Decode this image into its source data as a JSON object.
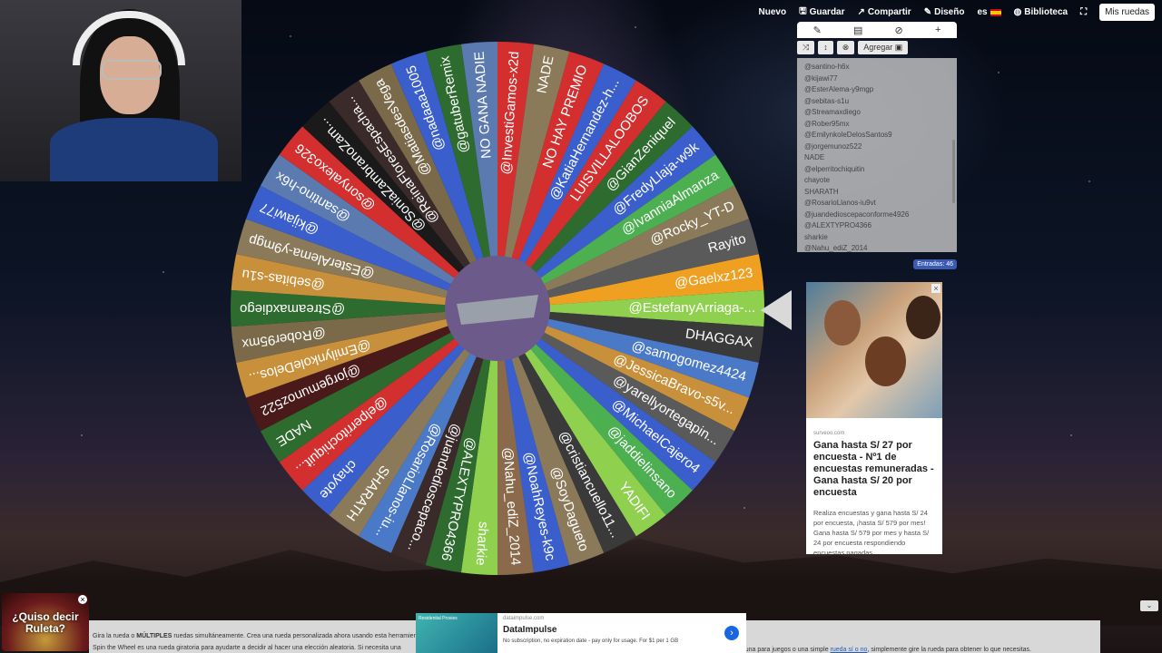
{
  "topnav": {
    "nuevo": "Nuevo",
    "guardar": "Guardar",
    "compartir": "Compartir",
    "diseno": "Diseño",
    "lang": "es",
    "biblioteca": "Biblioteca",
    "mis_ruedas": "Mis ruedas"
  },
  "wheel": {
    "slices": [
      {
        "label": "@Gaelxz123",
        "color": "#f0a020"
      },
      {
        "label": "@EstefanyArriaga-...",
        "color": "#8fd14f"
      },
      {
        "label": "DHAGGAX",
        "color": "#3a3a3a"
      },
      {
        "label": "@samogomez4424",
        "color": "#4a79c8"
      },
      {
        "label": "@JessicaBravo-s5v...",
        "color": "#c8903a"
      },
      {
        "label": "@yarellyortegapin...",
        "color": "#5a5a5a"
      },
      {
        "label": "@MichaelCajero4",
        "color": "#3a5fcd"
      },
      {
        "label": "@jaddielinsano",
        "color": "#4caf50"
      },
      {
        "label": "YADIFI",
        "color": "#8fd14f"
      },
      {
        "label": "@cristiancuello11...",
        "color": "#3a3a3a"
      },
      {
        "label": "@SoyDagueto",
        "color": "#8b7a5a"
      },
      {
        "label": "@NoahReyes-k9c",
        "color": "#3a5fcd"
      },
      {
        "label": "@Nahu_ediZ_2014",
        "color": "#8a6a4a"
      },
      {
        "label": "sharkie",
        "color": "#8fd14f"
      },
      {
        "label": "@ALEXTYPRO4366",
        "color": "#2e6b2e"
      },
      {
        "label": "@juandedioscepaco...",
        "color": "#3a2a2a"
      },
      {
        "label": "@RosarioLlanos-iu...",
        "color": "#4a79c8"
      },
      {
        "label": "SHARATH",
        "color": "#8b7a5a"
      },
      {
        "label": "chayote",
        "color": "#3a5fcd"
      },
      {
        "label": "@elperritochiquit...",
        "color": "#d32f2f"
      },
      {
        "label": "NADE",
        "color": "#2e6b2e"
      },
      {
        "label": "@jorgemunoz522",
        "color": "#4a1a1a"
      },
      {
        "label": "@EmilynkoleDelos...",
        "color": "#c8903a"
      },
      {
        "label": "@Rober95mx",
        "color": "#7a6a4a"
      },
      {
        "label": "@Streamaxdiego",
        "color": "#2e6b2e"
      },
      {
        "label": "@sebitas-s1u",
        "color": "#c8903a"
      },
      {
        "label": "@EsterAlema-y9mgp",
        "color": "#8b7a5a"
      },
      {
        "label": "@kijawi77",
        "color": "#3a5fcd"
      },
      {
        "label": "@santino-h6x",
        "color": "#5a7ab0"
      },
      {
        "label": "@sonyalexo326",
        "color": "#d32f2f"
      },
      {
        "label": "@SoniaZambranoZam...",
        "color": "#1a1a1a"
      },
      {
        "label": "@ReinaFloresEspacha...",
        "color": "#3a2a2a"
      },
      {
        "label": "@MatiasdesVega",
        "color": "#7a6a4a"
      },
      {
        "label": "@nadaaa1005",
        "color": "#3a5fcd"
      },
      {
        "label": "@gatuberRemix",
        "color": "#2e6b2e"
      },
      {
        "label": "NO GANA NADIE",
        "color": "#5a7ab0"
      },
      {
        "label": "@InvestiGamos-x2d",
        "color": "#d32f2f"
      },
      {
        "label": "NADE",
        "color": "#8b7a5a"
      },
      {
        "label": "NO HAY PREMIO",
        "color": "#d32f2f"
      },
      {
        "label": "@KatiaHernandez-h...",
        "color": "#3a5fcd"
      },
      {
        "label": "LUISVILLALOOBOS",
        "color": "#d32f2f"
      },
      {
        "label": "@GianZeniquel",
        "color": "#2e6b2e"
      },
      {
        "label": "@FredyLlaja-w9k",
        "color": "#3a5fcd"
      },
      {
        "label": "@IvanniaAlmanza",
        "color": "#4caf50"
      },
      {
        "label": "@Rocky_YT-D",
        "color": "#8b7a5a"
      },
      {
        "label": "Rayito",
        "color": "#5a5a5a"
      }
    ]
  },
  "panel": {
    "tabs": [
      "✎",
      "▤",
      "⊘",
      "+"
    ],
    "tools": [
      "⤨",
      "↕",
      "⊗",
      "Agregar ▣"
    ],
    "entries": [
      "@santino-h6x",
      "@kijawi77",
      "@EsterAlema-y9mgp",
      "@sebitas-s1u",
      "@Streamaxdiego",
      "@Rober95mx",
      "@EmilynkoleDelosSantos9",
      "@jorgemunoz522",
      "NADE",
      "@elperritochiquitin",
      "chayote",
      "SHARATH",
      "@RosarioLlanos-iu9vt",
      "@juandedioscepaconforme4926",
      "@ALEXTYPRO4366",
      "sharkie",
      "@Nahu_ediZ_2014"
    ],
    "count": "Entradas: 46"
  },
  "ad": {
    "source": "surveoo.com",
    "title": "Gana hasta S/ 27 por encuesta - Nº1 de encuestas remuneradas - Gana hasta S/ 20 por encuesta",
    "desc": "Realiza encuestas y gana hasta S/ 24 por encuesta, ¡hasta S/ 579 por mes! Gana hasta S/ 579 por mes y hasta S/ 24 por encuesta respondiendo encuestas pagadas"
  },
  "promo": {
    "text": "¿Quiso decir Ruleta?"
  },
  "info": {
    "line1_a": "Gira la rueda o ",
    "line1_b": "MÚLTIPLES",
    "line1_c": " ruedas simultáneamente. Crea una rueda personalizada ahora usando esta herramienta",
    "line2": "Spin the Wheel es una rueda giratoria para ayudarte a decidir al hacer una elección aleatoria. Si necesita una",
    "line3_a": "rtuna para juegos o una simple ",
    "line3_link": "rueda sí o no",
    "line3_b": ", simplemente gire la rueda para obtener lo que necesitas."
  },
  "bottom_ad": {
    "domain": "dataimpulse.com",
    "name": "DataImpulse",
    "sub": "No subscription, no expiration date - pay only for usage. For $1 per 1 GB",
    "thumb_text": "Residential Proxies"
  }
}
